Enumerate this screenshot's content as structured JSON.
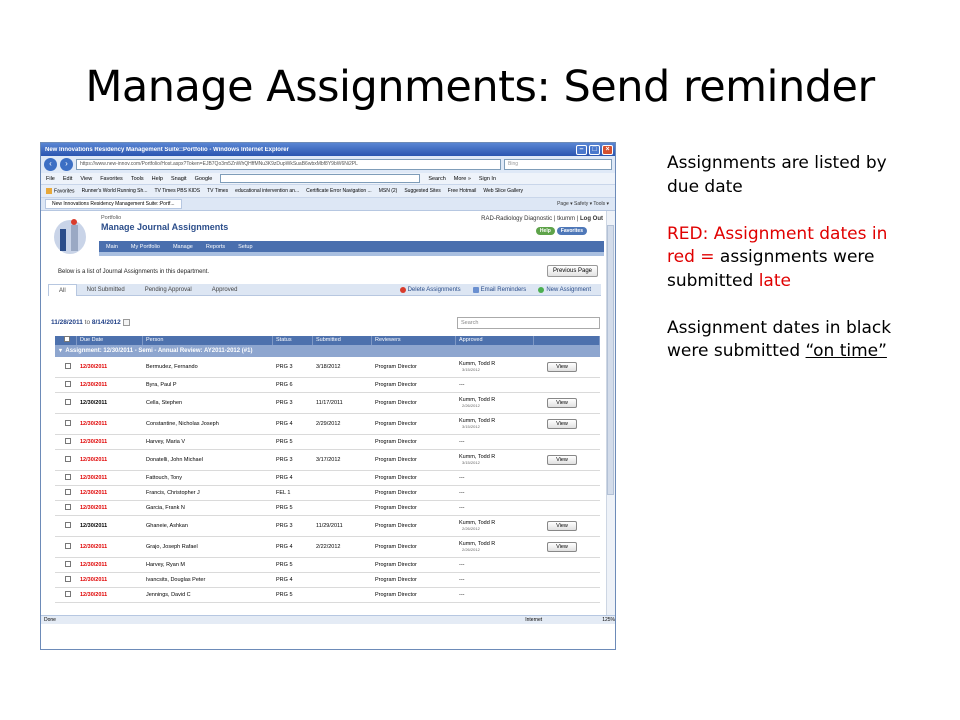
{
  "slide": {
    "title": "Manage Assignments:  Send reminder",
    "notes": {
      "p1": "Assignments are listed by due date",
      "p2_red": "RED:  Assignment dates in red =",
      "p2_black": " assignments were submitted ",
      "p2_late": "late",
      "p3": "Assignment dates in black were submitted ",
      "p3_underlined": "“on time”"
    }
  },
  "browser": {
    "window_title": "New Innovations Residency Management Suite::Portfolio - Windows Internet Explorer",
    "url": "https://www.new-innov.com/Portfolio/Host.aspx?Token=EJB7Qo3m5ZnWhQHffMNu3K9zDupWkSuaB6wbxMbf8Y9bW6Ni2PL",
    "search_placeholder": "Bing",
    "menu": [
      "File",
      "Edit",
      "View",
      "Favorites",
      "Tools",
      "Help"
    ],
    "toolbar_extras": [
      "Snagit",
      "Google",
      "Search",
      "More »",
      "Sign In"
    ],
    "favorites_label": "Favorites",
    "favorites": [
      "Runner's World Running Sh...",
      "TV Times PBS KIDS",
      "TV Times",
      "educational intervention an...",
      "Certificate Error Navigation ...",
      "MSN (2)",
      "Suggested Sites",
      "Free Hotmail",
      "Web Slice Gallery"
    ],
    "tab": "New Innovations Residency Management Suite::Portf...",
    "tab_tools": "Page ▾  Safety ▾  Tools ▾",
    "status_left": "Done",
    "status_zone": "Internet",
    "zoom": "125%"
  },
  "app": {
    "breadcrumb": "Portfolio",
    "page_title": "Manage Journal Assignments",
    "user_line_prefix": "RAD-Radiology Diagnostic | ",
    "user_name": "tkumm",
    "logout": "Log Out",
    "help": "Help",
    "favorites_btn": "Favorites",
    "nav": [
      "Main",
      "My Portfolio",
      "Manage",
      "Reports",
      "Setup"
    ],
    "intro": "Below is a list of Journal Assignments in this department.",
    "previous_page": "Previous Page",
    "filter_tabs": [
      "All",
      "Not Submitted",
      "Pending Approval",
      "Approved"
    ],
    "actions": {
      "delete": "Delete Assignments",
      "email": "Email Reminders",
      "new": "New Assignment"
    },
    "date_from": "11/28/2011",
    "date_to_label": "to",
    "date_to": "8/14/2012",
    "search_placeholder": "Search",
    "columns": [
      "",
      "Due Date",
      "Person",
      "Status",
      "Submitted",
      "Reviewers",
      "Approved"
    ],
    "group_label": "Assignment: 12/30/2011 - Semi - Annual Review: AY2011-2012 (#1)",
    "view_label": "View",
    "rows": [
      {
        "due": "12/30/2011",
        "late": true,
        "person": "Bermudez, Fernando",
        "status": "PRG 3",
        "submitted": "3/18/2012",
        "reviewer": "Program Director",
        "approved": "Kumm, Todd R",
        "approved_date": "3/15/2012",
        "view": true
      },
      {
        "due": "12/30/2011",
        "late": true,
        "person": "Byra, Paul P",
        "status": "PRG 6",
        "submitted": "",
        "reviewer": "Program Director",
        "approved": "---",
        "approved_date": "",
        "view": false
      },
      {
        "due": "12/30/2011",
        "late": false,
        "person": "Cella, Stephen",
        "status": "PRG 3",
        "submitted": "11/17/2011",
        "reviewer": "Program Director",
        "approved": "Kumm, Todd R",
        "approved_date": "2/26/2012",
        "view": true
      },
      {
        "due": "12/30/2011",
        "late": true,
        "person": "Constantine, Nicholas Joseph",
        "status": "PRG 4",
        "submitted": "2/29/2012",
        "reviewer": "Program Director",
        "approved": "Kumm, Todd R",
        "approved_date": "3/15/2012",
        "view": true
      },
      {
        "due": "12/30/2011",
        "late": true,
        "person": "Harvey, Maria V",
        "status": "PRG 5",
        "submitted": "",
        "reviewer": "Program Director",
        "approved": "---",
        "approved_date": "",
        "view": false
      },
      {
        "due": "12/30/2011",
        "late": true,
        "person": "Donatelli, John Michael",
        "status": "PRG 3",
        "submitted": "3/17/2012",
        "reviewer": "Program Director",
        "approved": "Kumm, Todd R",
        "approved_date": "3/15/2012",
        "view": true
      },
      {
        "due": "12/30/2011",
        "late": true,
        "person": "Fattouch, Tony",
        "status": "PRG 4",
        "submitted": "",
        "reviewer": "Program Director",
        "approved": "---",
        "approved_date": "",
        "view": false
      },
      {
        "due": "12/30/2011",
        "late": true,
        "person": "Francis, Christopher J",
        "status": "FEL 1",
        "submitted": "",
        "reviewer": "Program Director",
        "approved": "---",
        "approved_date": "",
        "view": false
      },
      {
        "due": "12/30/2011",
        "late": true,
        "person": "Garcia, Frank N",
        "status": "PRG 5",
        "submitted": "",
        "reviewer": "Program Director",
        "approved": "---",
        "approved_date": "",
        "view": false
      },
      {
        "due": "12/30/2011",
        "late": false,
        "person": "Ghaneie, Ashkan",
        "status": "PRG 3",
        "submitted": "11/29/2011",
        "reviewer": "Program Director",
        "approved": "Kumm, Todd R",
        "approved_date": "2/26/2012",
        "view": true
      },
      {
        "due": "12/30/2011",
        "late": true,
        "person": "Grajo, Joseph Rafael",
        "status": "PRG 4",
        "submitted": "2/22/2012",
        "reviewer": "Program Director",
        "approved": "Kumm, Todd R",
        "approved_date": "2/26/2012",
        "view": true
      },
      {
        "due": "12/30/2011",
        "late": true,
        "person": "Harvey, Ryan M",
        "status": "PRG 5",
        "submitted": "",
        "reviewer": "Program Director",
        "approved": "---",
        "approved_date": "",
        "view": false
      },
      {
        "due": "12/30/2011",
        "late": true,
        "person": "Ivancsits, Douglas Peter",
        "status": "PRG 4",
        "submitted": "",
        "reviewer": "Program Director",
        "approved": "---",
        "approved_date": "",
        "view": false
      },
      {
        "due": "12/30/2011",
        "late": true,
        "person": "Jennings, David C",
        "status": "PRG 5",
        "submitted": "",
        "reviewer": "Program Director",
        "approved": "---",
        "approved_date": "",
        "view": false
      }
    ]
  },
  "colors": {
    "late": "#e00000",
    "nav": "#4a6fae",
    "header": "#4d71ad",
    "group": "#8ea6cf"
  }
}
